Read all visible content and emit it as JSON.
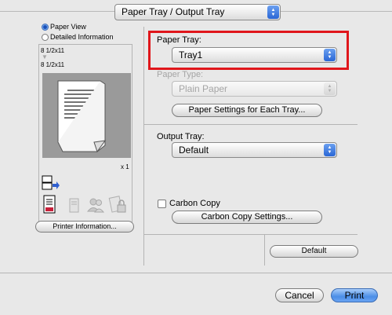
{
  "header": {
    "panel_popup": "Paper Tray / Output Tray"
  },
  "left_panel": {
    "radio_paper_view": "Paper View",
    "radio_detailed_info": "Detailed Information",
    "size_top": "8 1/2x11",
    "size_bottom": "8 1/2x11",
    "copies": "x 1",
    "printer_info_button": "Printer Information..."
  },
  "paper_tray": {
    "label": "Paper Tray:",
    "value": "Tray1",
    "highlight_color": "#e0161b"
  },
  "paper_type": {
    "label": "Paper Type:",
    "value": "Plain Paper"
  },
  "paper_settings_button": "Paper Settings for Each Tray...",
  "output_tray": {
    "label": "Output Tray:",
    "value": "Default"
  },
  "carbon_copy": {
    "checkbox_label": "Carbon Copy",
    "checked": false,
    "settings_button": "Carbon Copy Settings..."
  },
  "default_button": "Default",
  "footer": {
    "cancel_button": "Cancel",
    "print_button": "Print"
  },
  "icons": [
    "output-tray-icon",
    "document-icon",
    "staple-icon",
    "users-icon",
    "lock-icon",
    "down-arrow-icon"
  ],
  "colors": {
    "accent": "#3b7fe3",
    "background": "#e8e8e8"
  }
}
